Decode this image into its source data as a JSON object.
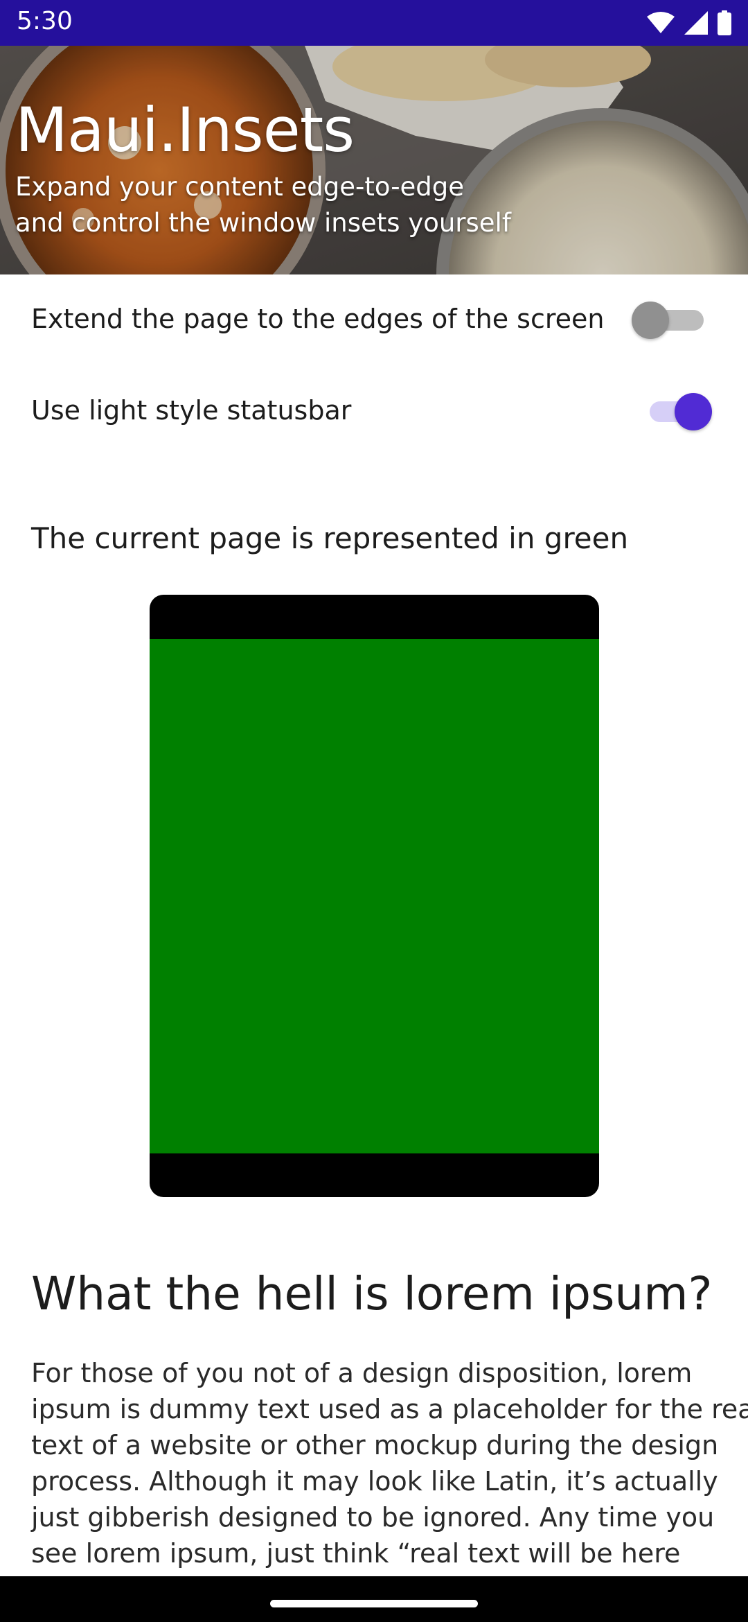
{
  "status_bar": {
    "time": "5:30",
    "background": "#25109c",
    "icons": [
      "wifi-icon",
      "cellular-signal-icon",
      "battery-icon"
    ]
  },
  "header": {
    "title": "Maui.Insets",
    "subtitle_line1": "Expand your content edge-to-edge",
    "subtitle_line2": "and control the window insets yourself"
  },
  "settings": {
    "extend_label": "Extend the page to the edges of the screen",
    "extend_on": false,
    "light_statusbar_label": "Use light style statusbar",
    "light_statusbar_on": true,
    "accent": "#512bd4"
  },
  "preview": {
    "caption": "The current page is represented in green",
    "page_color": "#008000",
    "frame_color": "#000000"
  },
  "article": {
    "heading": "What the hell is lorem ipsum?",
    "lines": [
      "For those of you not of a design disposition, lorem",
      "ipsum is dummy text used as a placeholder for the real",
      "text of a website or other mockup during the design",
      "process. Although it may look like Latin, it’s actually",
      "just gibberish designed to be ignored. Any time you",
      "see lorem ipsum, just think “real text will be here"
    ]
  },
  "nav_bar": {
    "handle": "gesture-handle"
  }
}
